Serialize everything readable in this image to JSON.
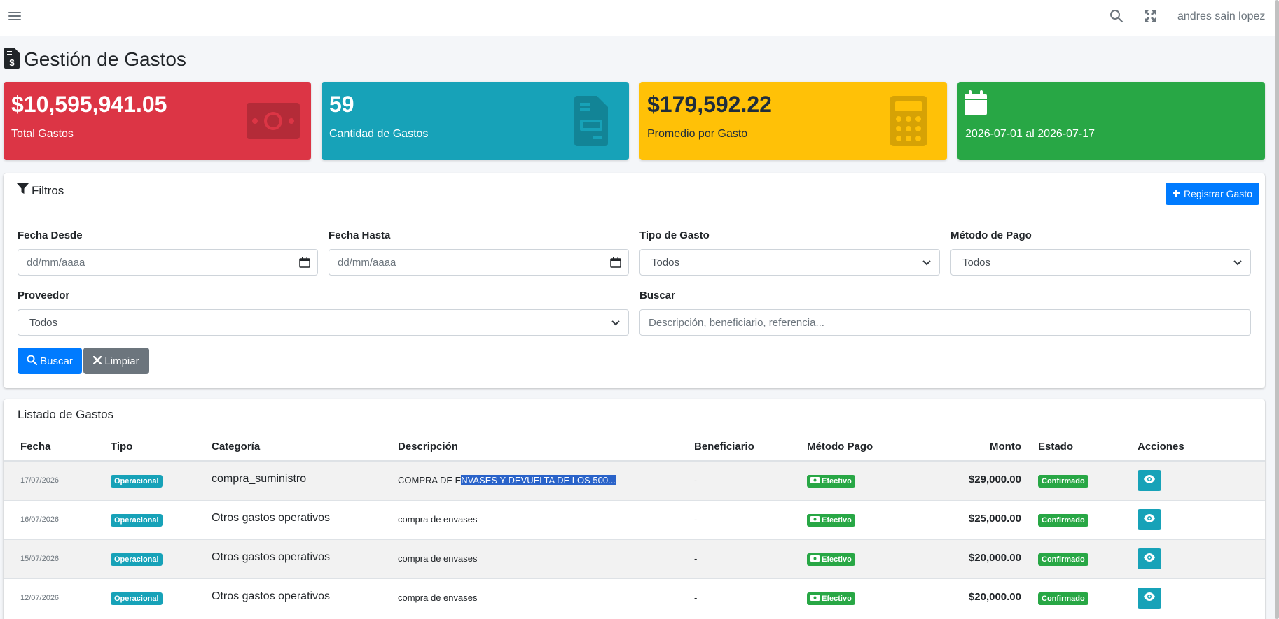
{
  "navbar": {
    "user_name": "andres sain lopez",
    "icons": [
      "menu-icon",
      "search-icon",
      "expand-icon"
    ]
  },
  "page": {
    "title": "Gestión de Gastos",
    "title_icon": "file-invoice-dollar-icon"
  },
  "stats": [
    {
      "value": "$10,595,941.05",
      "label": "Total Gastos",
      "color": "#dc3545",
      "icon": "money-bill-icon"
    },
    {
      "value": "59",
      "label": "Cantidad de Gastos",
      "color": "#17a2b8",
      "icon": "file-invoice-icon"
    },
    {
      "value": "$179,592.22",
      "label": "Promedio por Gasto",
      "color": "#ffc107",
      "icon": "calculator-icon"
    },
    {
      "value": "",
      "label": "2026-07-01 al 2026-07-17",
      "color": "#28a745",
      "icon": "calendar-icon"
    }
  ],
  "filters": {
    "title": "Filtros",
    "register_button": "Registrar Gasto",
    "fecha_desde": {
      "label": "Fecha Desde",
      "placeholder": "dd/mm/aaaa"
    },
    "fecha_hasta": {
      "label": "Fecha Hasta",
      "placeholder": "dd/mm/aaaa"
    },
    "tipo_gasto": {
      "label": "Tipo de Gasto",
      "value": "Todos"
    },
    "metodo_pago": {
      "label": "Método de Pago",
      "value": "Todos"
    },
    "proveedor": {
      "label": "Proveedor",
      "value": "Todos"
    },
    "buscar": {
      "label": "Buscar",
      "placeholder": "Descripción, beneficiario, referencia..."
    },
    "buscar_button": "Buscar",
    "limpiar_button": "Limpiar"
  },
  "list": {
    "title": "Listado de Gastos",
    "columns": [
      "Fecha",
      "Tipo",
      "Categoría",
      "Descripción",
      "Beneficiario",
      "Método Pago",
      "Monto",
      "Estado",
      "Acciones"
    ],
    "rows": [
      {
        "fecha": "17/07/2026",
        "tipo": "Operacional",
        "categoria": "compra_suministro",
        "descripcion_pre": "COMPRA DE E",
        "descripcion_sel": "NVASES Y DEVUELTA DE LOS 500...",
        "beneficiario": "-",
        "metodo": "Efectivo",
        "monto": "$29,000.00",
        "estado": "Confirmado"
      },
      {
        "fecha": "16/07/2026",
        "tipo": "Operacional",
        "categoria": "Otros gastos operativos",
        "descripcion_pre": "compra de envases",
        "descripcion_sel": "",
        "beneficiario": "-",
        "metodo": "Efectivo",
        "monto": "$25,000.00",
        "estado": "Confirmado"
      },
      {
        "fecha": "15/07/2026",
        "tipo": "Operacional",
        "categoria": "Otros gastos operativos",
        "descripcion_pre": "compra de envases",
        "descripcion_sel": "",
        "beneficiario": "-",
        "metodo": "Efectivo",
        "monto": "$20,000.00",
        "estado": "Confirmado"
      },
      {
        "fecha": "12/07/2026",
        "tipo": "Operacional",
        "categoria": "Otros gastos operativos",
        "descripcion_pre": "compra de envases",
        "descripcion_sel": "",
        "beneficiario": "-",
        "metodo": "Efectivo",
        "monto": "$20,000.00",
        "estado": "Confirmado"
      }
    ]
  }
}
